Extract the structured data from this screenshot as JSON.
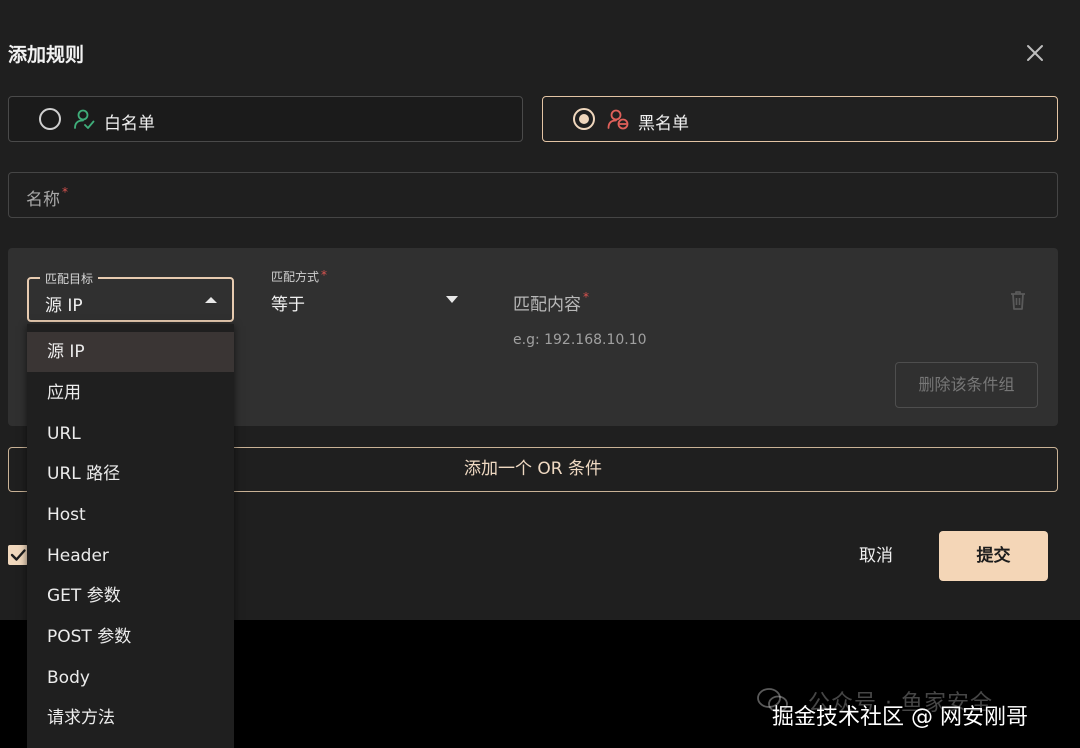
{
  "dialog": {
    "title": "添加规则",
    "close_icon": "close-icon"
  },
  "list_type": {
    "options": [
      {
        "label": "白名单",
        "icon": "user-check-icon",
        "selected": false,
        "icon_color": "#3fae7a"
      },
      {
        "label": "黑名单",
        "icon": "user-block-icon",
        "selected": true,
        "icon_color": "#e0605a"
      }
    ]
  },
  "name_field": {
    "label": "名称",
    "required_mark": "*",
    "value": ""
  },
  "condition": {
    "target": {
      "legend": "匹配目标",
      "value": "源 IP"
    },
    "method": {
      "label": "匹配方式",
      "required_mark": "*",
      "value": "等于"
    },
    "content": {
      "label": "匹配内容",
      "required_mark": "*",
      "hint": "e.g: 192.168.10.10"
    },
    "delete_group_label": "删除该条件组"
  },
  "add_or_label": "添加一个 OR 条件",
  "enabled_checked": true,
  "footer": {
    "cancel_label": "取消",
    "submit_label": "提交"
  },
  "dropdown": {
    "items": [
      "源 IP",
      "应用",
      "URL",
      "URL 路径",
      "Host",
      "Header",
      "GET 参数",
      "POST 参数",
      "Body",
      "请求方法"
    ],
    "selected_index": 0
  },
  "watermark": {
    "background_text": "公众号 · 鱼家安全",
    "text": "掘金技术社区 @ 网安刚哥"
  },
  "colors": {
    "accent": "#f4d6b7",
    "required": "#d9534f",
    "background": "#1f1f1f",
    "panel": "#303030"
  }
}
